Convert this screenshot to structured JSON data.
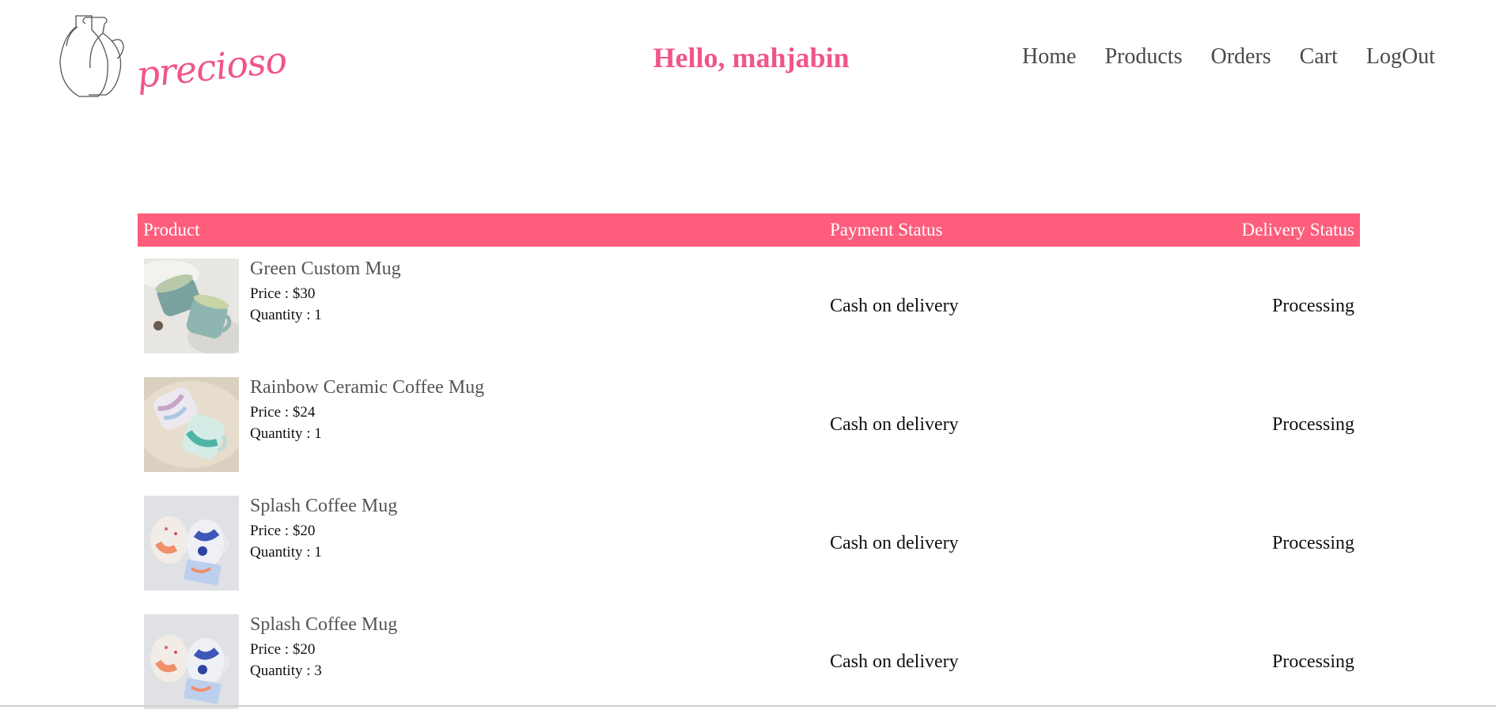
{
  "brand": {
    "logo_text": "precioso"
  },
  "header": {
    "greeting": "Hello, mahjabin"
  },
  "nav": {
    "items": [
      {
        "label": "Home"
      },
      {
        "label": "Products"
      },
      {
        "label": "Orders"
      },
      {
        "label": "Cart"
      },
      {
        "label": "LogOut"
      }
    ]
  },
  "table": {
    "headers": {
      "product": "Product",
      "payment": "Payment Status",
      "delivery": "Delivery Status"
    },
    "rows": [
      {
        "name": "Green Custom Mug",
        "price": "Price : $30",
        "quantity": "Quantity : 1",
        "payment": "Cash on delivery",
        "delivery": "Processing",
        "image": "green-mugs"
      },
      {
        "name": "Rainbow Ceramic Coffee Mug",
        "price": "Price : $24",
        "quantity": "Quantity : 1",
        "payment": "Cash on delivery",
        "delivery": "Processing",
        "image": "rainbow-mugs"
      },
      {
        "name": "Splash Coffee Mug",
        "price": "Price : $20",
        "quantity": "Quantity : 1",
        "payment": "Cash on delivery",
        "delivery": "Processing",
        "image": "splash-mugs"
      },
      {
        "name": "Splash Coffee Mug",
        "price": "Price : $20",
        "quantity": "Quantity : 3",
        "payment": "Cash on delivery",
        "delivery": "Processing",
        "image": "splash-mugs"
      }
    ]
  },
  "colors": {
    "accent": "#fe5d7c",
    "greeting": "#f0558a",
    "nav_text": "#4a4a4a"
  }
}
